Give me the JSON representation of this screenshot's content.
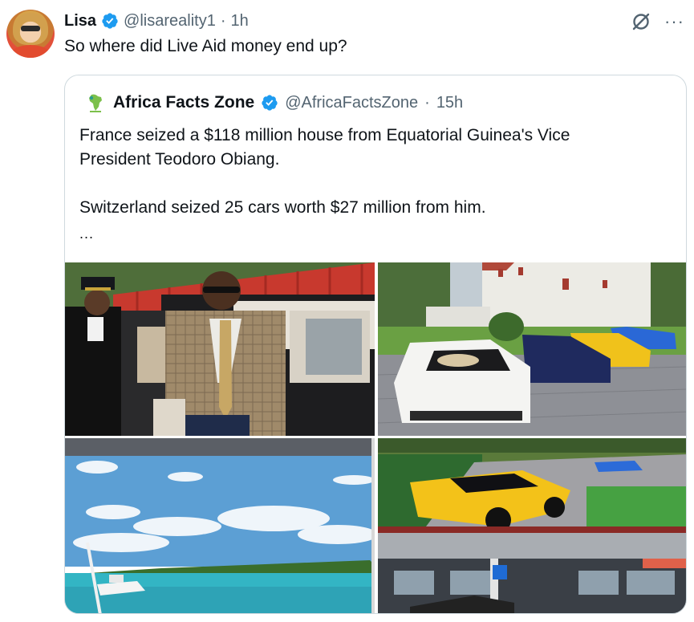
{
  "tweet": {
    "author_name": "Lisa",
    "author_handle": "@lisareality1",
    "separator": "·",
    "time": "1h",
    "text": "So where did Live Aid money end up?",
    "icons": {
      "verified": "verified-badge-icon",
      "grok": "grok-icon",
      "more": "more-options-icon"
    },
    "more_label": "···"
  },
  "quote": {
    "author_name": "Africa Facts Zone",
    "author_handle": "@AfricaFactsZone",
    "separator": "·",
    "time": "15h",
    "line1": "France seized a $118 million house from Equatorial Guinea's Vice",
    "line2": "President Teodoro Obiang.",
    "line3": "Switzerland seized 25 cars worth $27 million from him.",
    "ellipsis": "...",
    "media": [
      {
        "name": "photo-man-exiting-car"
      },
      {
        "name": "photo-supercars-lawn"
      },
      {
        "name": "photo-yacht-sea"
      },
      {
        "name": "photo-yellow-supercar"
      }
    ]
  },
  "colors": {
    "text": "#0f1419",
    "secondary": "#536471",
    "verified": "#1d9bf0",
    "border": "#cfd9de"
  }
}
